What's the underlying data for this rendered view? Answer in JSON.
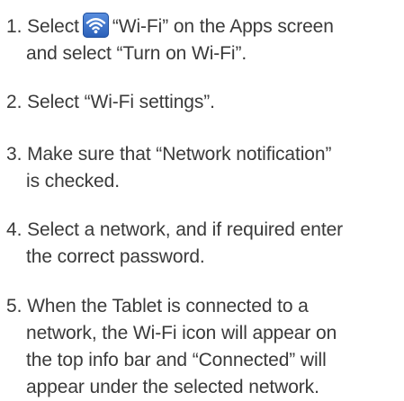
{
  "steps": [
    {
      "number": "1.",
      "line1_before_icon": "Select",
      "icon": "wifi-icon",
      "line1_after_icon": "“Wi-Fi” on the Apps screen",
      "line2": "and select “Turn on Wi-Fi”."
    },
    {
      "number": "2.",
      "line1": "Select “Wi-Fi settings”."
    },
    {
      "number": "3.",
      "line1": "Make sure that “Network notification”",
      "line2": "is checked."
    },
    {
      "number": "4.",
      "line1": "Select a network, and if required enter",
      "line2": "the correct password."
    },
    {
      "number": "5.",
      "line1": "When the Tablet is connected to a",
      "line2": "network, the Wi-Fi icon will appear on",
      "line3": "the top info bar and “Connected” will",
      "line4": "appear under the selected network."
    }
  ],
  "colors": {
    "text": "#3a3a3a",
    "icon_bg": "#3b72cc"
  }
}
